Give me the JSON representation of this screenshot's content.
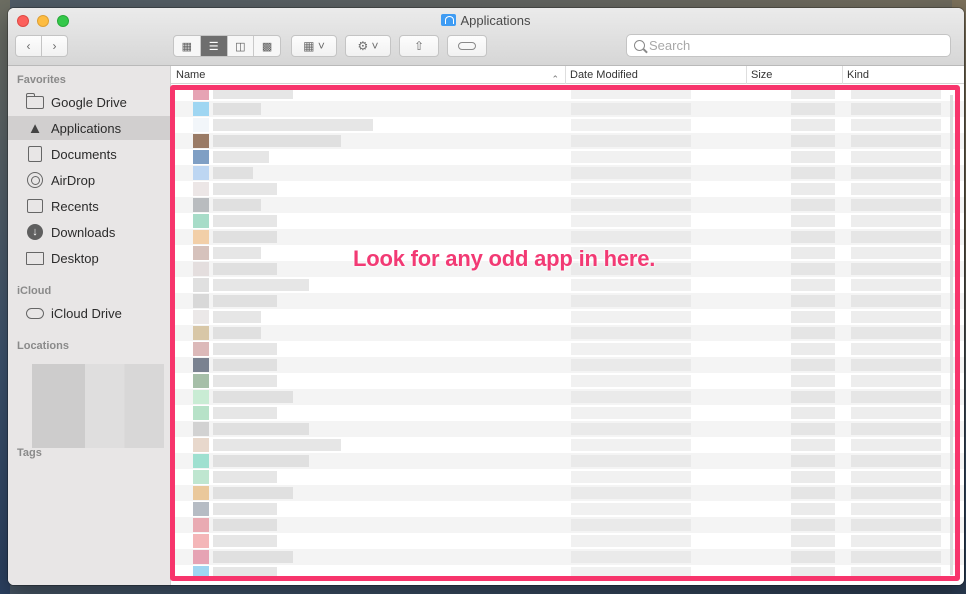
{
  "window": {
    "title": "Applications"
  },
  "toolbar": {
    "back_icon": "chevron-left-icon",
    "forward_icon": "chevron-right-icon",
    "views": [
      "icon-view",
      "list-view",
      "column-view",
      "gallery-view"
    ],
    "active_view": "list-view",
    "search_placeholder": "Search"
  },
  "sidebar": {
    "favorites_label": "Favorites",
    "favorites": [
      {
        "label": "Google Drive",
        "icon": "folder-icon"
      },
      {
        "label": "Applications",
        "icon": "applications-icon",
        "selected": true
      },
      {
        "label": "Documents",
        "icon": "document-icon"
      },
      {
        "label": "AirDrop",
        "icon": "airdrop-icon"
      },
      {
        "label": "Recents",
        "icon": "clock-icon"
      },
      {
        "label": "Downloads",
        "icon": "download-icon"
      },
      {
        "label": "Desktop",
        "icon": "desktop-icon"
      }
    ],
    "icloud_label": "iCloud",
    "icloud": [
      {
        "label": "iCloud Drive",
        "icon": "cloud-icon"
      }
    ],
    "locations_label": "Locations",
    "tags_label": "Tags"
  },
  "columns": {
    "name": "Name",
    "date_modified": "Date Modified",
    "size": "Size",
    "kind": "Kind"
  },
  "annotation": {
    "text": "Look for any odd app in here.",
    "color": "#f23a74"
  },
  "colors": {
    "highlight_border": "#f7356c",
    "selected_sidebar": "#d1cfcf"
  },
  "app_icon_colors": [
    "#e6a3b4",
    "#9fd6f2",
    "#f2f6fa",
    "#9a7b66",
    "#7f9fc4",
    "#bdd6f2",
    "#ece6e6",
    "#b9bcbf",
    "#a7dcc8",
    "#f2cfa8",
    "#d6c2bc",
    "#e4dede",
    "#e0e0e0",
    "#d8d8d8",
    "#ebe8e8",
    "#d8c7a7",
    "#dcb9b9",
    "#7a8290",
    "#a6bfa8",
    "#c9ecd4",
    "#b7e2c8",
    "#d2d2d2",
    "#e8d8cc",
    "#9fe0d0",
    "#bfe6d0",
    "#eac89b",
    "#b6bcc4",
    "#e9aab2",
    "#f4b6b8"
  ]
}
